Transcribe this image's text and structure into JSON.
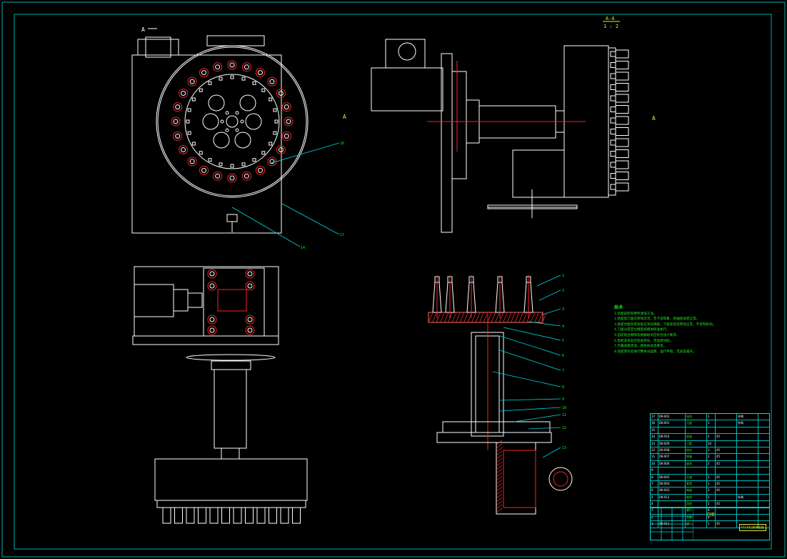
{
  "drawing": {
    "colors": {
      "background": "#000000",
      "outline": "#ffffff",
      "section": "#ff2020",
      "leader": "#00d8d8",
      "notes": "#22ee22",
      "title": "#e8e830"
    },
    "view_labels": {
      "top_left": "A",
      "right_a": "A",
      "section_top": "A-A",
      "section_scale": "1 : 2",
      "left_a": "A"
    },
    "view1_callouts": [
      "16",
      "17",
      "14"
    ],
    "section_callouts": [
      "1",
      "2",
      "3",
      "4",
      "5",
      "6",
      "7",
      "8",
      "9",
      "10",
      "11",
      "12",
      "13"
    ]
  },
  "notes": {
    "title": "技术",
    "lines": [
      "1.装配前所有零件清洗干净。",
      "2.装配后刀盘应转动灵活，无卡滞现象，各轴承运转正常。",
      "3.各配合面及密封处应涂润滑脂，刀套安装后转动正常，不得有松动。",
      "4.刀盘分度定位精度按相关标准执行。",
      "5.齿轮啮合侧隙及接触斑点应符合设计要求。",
      "6.电机安装后应检查转向，空运转试验。",
      "7.外露表面涂漆，颜色按总装要求。",
      "8.装配完毕后进行整体试运转，运行平稳，无异常噪声。"
    ]
  },
  "title_block": {
    "rows": [
      [
        "17",
        "DK-002",
        "电机",
        "1",
        "",
        "外购",
        ""
      ],
      [
        "16",
        "DK-001",
        "刀盘",
        "1",
        "",
        "外购",
        ""
      ],
      [
        "15",
        "",
        "",
        "",
        "",
        "",
        ""
      ],
      [
        "14",
        "DK-010",
        "底座",
        "1",
        "45",
        "",
        ""
      ],
      [
        "13",
        "DK-009",
        "刀套",
        "24",
        "",
        "",
        ""
      ],
      [
        "12",
        "DK-008",
        "拨叉",
        "1",
        "45",
        "",
        ""
      ],
      [
        "11",
        "DK-007",
        "销轴",
        "2",
        "45",
        "",
        ""
      ],
      [
        "10",
        "DK-006",
        "轴承",
        "2",
        "45",
        "",
        ""
      ],
      [
        "9",
        "",
        "",
        "",
        "",
        "",
        ""
      ],
      [
        "8",
        "DK-005",
        "主轴",
        "1",
        "45",
        "",
        ""
      ],
      [
        "7",
        "DK-004",
        "套筒",
        "1",
        "45",
        "",
        ""
      ],
      [
        "6",
        "DK-003",
        "端盖",
        "2",
        "45",
        "",
        ""
      ],
      [
        "5",
        "DK-012",
        "轴承",
        "2",
        "",
        "外购",
        ""
      ],
      [
        "4",
        "",
        "齿轮",
        "1",
        "45",
        "",
        ""
      ],
      [
        "3",
        "",
        "螺钉",
        "4",
        "",
        "",
        ""
      ],
      [
        "2",
        "",
        "垫圈",
        "4",
        "",
        "",
        ""
      ],
      [
        "1",
        "DK-011",
        "键",
        "1",
        "45",
        "",
        ""
      ]
    ],
    "name": "刀库",
    "description": "FY130刀库装配图"
  }
}
